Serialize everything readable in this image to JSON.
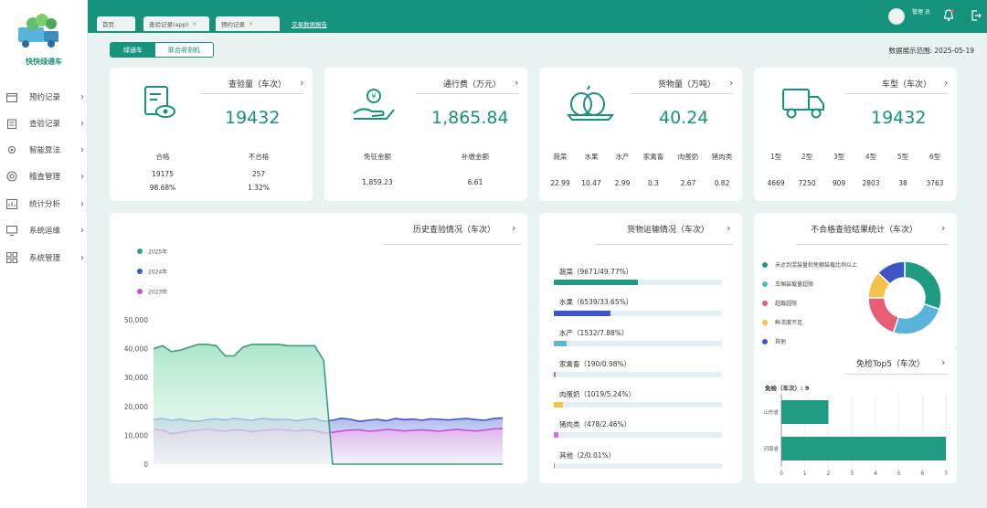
{
  "app": {
    "name": "快快绿通车"
  },
  "sidebar": {
    "items": [
      {
        "label": "预约记录",
        "icon": "calendar-icon"
      },
      {
        "label": "查验记录",
        "icon": "clipboard-icon"
      },
      {
        "label": "智能算法",
        "icon": "gear-icon"
      },
      {
        "label": "稽查管理",
        "icon": "shield-icon"
      },
      {
        "label": "统计分析",
        "icon": "chart-icon"
      },
      {
        "label": "系统运维",
        "icon": "monitor-icon"
      },
      {
        "label": "系统管理",
        "icon": "grid-icon"
      }
    ]
  },
  "tabs": [
    {
      "label": "首页",
      "active": false,
      "closable": false
    },
    {
      "label": "查验记录(app)",
      "active": false,
      "closable": true
    },
    {
      "label": "预约记录",
      "active": false,
      "closable": true
    },
    {
      "label": "交易数据报告",
      "active": true,
      "closable": false
    }
  ],
  "user": {
    "name": "管理\n员"
  },
  "toggle": {
    "options": [
      "绿通车",
      "联合收割机"
    ],
    "selected": 0
  },
  "date_range": "数据展示范围: 2025-05-19",
  "cards": {
    "inspection": {
      "title": "查验量（车次）",
      "value": "19432",
      "items": [
        {
          "label": "合格",
          "value": "19175",
          "pct": "98.68%"
        },
        {
          "label": "不合格",
          "value": "257",
          "pct": "1.32%"
        }
      ]
    },
    "toll": {
      "title": "通行费（万元）",
      "value": "1,865.84",
      "items": [
        {
          "label": "免征金额",
          "value": "1,859.23"
        },
        {
          "label": "补缴金额",
          "value": "6.61"
        }
      ]
    },
    "cargo": {
      "title": "货物量（万吨）",
      "value": "40.24",
      "items": [
        {
          "label": "蔬菜",
          "value": "22.99"
        },
        {
          "label": "水果",
          "value": "10.47"
        },
        {
          "label": "水产",
          "value": "2.99"
        },
        {
          "label": "家禽畜",
          "value": "0.3"
        },
        {
          "label": "肉蛋奶",
          "value": "2.67"
        },
        {
          "label": "猪肉类",
          "value": "0.82"
        }
      ]
    },
    "vehicle": {
      "title": "车型（车次）",
      "value": "19432",
      "items": [
        {
          "label": "1型",
          "value": "4669"
        },
        {
          "label": "2型",
          "value": "7250"
        },
        {
          "label": "3型",
          "value": "909"
        },
        {
          "label": "4型",
          "value": "2803"
        },
        {
          "label": "5型",
          "value": "38"
        },
        {
          "label": "6型",
          "value": "3763"
        }
      ]
    }
  },
  "history": {
    "title": "历史查验情况（车次）",
    "legend": [
      "2025年",
      "2024年",
      "2023年"
    ],
    "colors": [
      "#3a9e80",
      "#3e55c8",
      "#c84ee0"
    ],
    "yticks": [
      "50,000",
      "40,000",
      "30,000",
      "20,000",
      "10,000",
      "0"
    ]
  },
  "transport": {
    "title": "货物运输情况（车次）",
    "items": [
      {
        "label": "蔬菜（9671/49.77%）",
        "pct": 49.77,
        "color": "#1f9b82"
      },
      {
        "label": "水果（6539/33.65%）",
        "pct": 33.65,
        "color": "#3e55c8"
      },
      {
        "label": "水产（1532/7.88%）",
        "pct": 7.88,
        "color": "#5ab3dd"
      },
      {
        "label": "家禽畜（190/0.98%）",
        "pct": 0.98,
        "color": "#e85d75"
      },
      {
        "label": "肉蛋奶（1019/5.24%）",
        "pct": 5.24,
        "color": "#f2c24b"
      },
      {
        "label": "猪肉类（478/2.46%）",
        "pct": 2.46,
        "color": "#e06adf"
      },
      {
        "label": "其他（2/0.01%）",
        "pct": 0.01,
        "color": "#999999"
      }
    ]
  },
  "failed": {
    "title": "不合格查验结果统计（车次）",
    "legend": [
      {
        "label": "未达到混装量和免额装载比例以上",
        "color": "#1f9b82"
      },
      {
        "label": "车厢装载量超限",
        "color": "#5ab3dd"
      },
      {
        "label": "超载超限",
        "color": "#e85d75"
      },
      {
        "label": "鲜活度不足",
        "color": "#f2c24b"
      },
      {
        "label": "其他",
        "color": "#3e55c8"
      }
    ],
    "donut": [
      30,
      25,
      20,
      12,
      13
    ]
  },
  "top5": {
    "title": "免检Top5（车次）",
    "subtitle": "免检（车次）: 9",
    "categories": [
      "山东省",
      "河南省"
    ],
    "xticks": [
      "0",
      "1",
      "2",
      "3",
      "4",
      "5",
      "6",
      "7"
    ]
  },
  "chart_data": [
    {
      "type": "area",
      "title": "历史查验情况（车次）",
      "ylim": [
        0,
        50000
      ],
      "series": [
        {
          "name": "2025年",
          "values": [
            40000,
            41000,
            39000,
            39500,
            40500,
            41500,
            41500,
            41000,
            37500,
            37500,
            40500,
            41500,
            41500,
            41500,
            41500,
            41000,
            41000,
            41000,
            41000,
            36000,
            0,
            0,
            0,
            0,
            0,
            0,
            0,
            0,
            0,
            0,
            0,
            0,
            0,
            0,
            0,
            0,
            0,
            0,
            0,
            0
          ]
        },
        {
          "name": "2024年",
          "values": [
            15500,
            15800,
            15200,
            15600,
            15000,
            14800,
            15400,
            15700,
            15300,
            15900,
            15500,
            15200,
            15800,
            15600,
            15400,
            15500,
            15000,
            15500,
            15800,
            14800,
            15200,
            15900,
            15500,
            14800,
            15200,
            15500,
            15000,
            15800,
            15400,
            15600,
            15200,
            15700,
            15500,
            15300,
            15600,
            15800,
            15400,
            15200,
            15800,
            16000
          ]
        },
        {
          "name": "2023年",
          "values": [
            12000,
            11800,
            10500,
            11000,
            11500,
            11800,
            12200,
            11600,
            11400,
            11900,
            11700,
            11300,
            11600,
            11900,
            12000,
            11700,
            11500,
            11800,
            11600,
            10800,
            11000,
            11500,
            11800,
            11900,
            11400,
            11600,
            12000,
            11800,
            11500,
            11700,
            11900,
            11600,
            11400,
            11800,
            12000,
            11700,
            11500,
            11800,
            12200,
            12300
          ]
        }
      ]
    },
    {
      "type": "bar",
      "title": "免检Top5（车次）",
      "categories": [
        "山东省",
        "河南省"
      ],
      "values": [
        2,
        7
      ],
      "xlim": [
        0,
        7
      ]
    }
  ]
}
